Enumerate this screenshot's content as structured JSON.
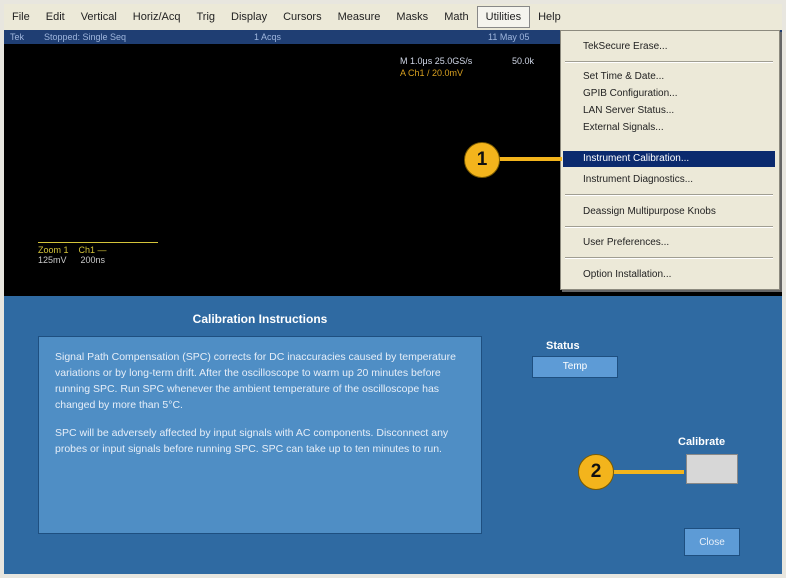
{
  "menubar": {
    "items": [
      "File",
      "Edit",
      "Vertical",
      "Horiz/Acq",
      "Trig",
      "Display",
      "Cursors",
      "Measure",
      "Masks",
      "Math",
      "Utilities",
      "Help"
    ],
    "active": "Utilities"
  },
  "scope": {
    "status": {
      "channel": "Tek",
      "state": "Stopped: Single Seq",
      "acqs": "1 Acqs",
      "date": "11 May 05"
    },
    "timebase": "M 1.0μs 25.0GS/s",
    "timebase_extra": "50.0k",
    "trigger": "A  Ch1  /  20.0mV",
    "ch_readout": {
      "row1_a": "Zoom 1",
      "row1_b": "Ch1 —",
      "row2_a": "125mV",
      "row2_b": "200ns"
    }
  },
  "utilities_menu": {
    "items": [
      {
        "label": "TekSecure Erase...",
        "group": 1
      },
      {
        "label": "Set Time & Date...",
        "group": 2
      },
      {
        "label": "GPIB Configuration...",
        "group": 2
      },
      {
        "label": "LAN Server Status...",
        "group": 2
      },
      {
        "label": "External Signals...",
        "group": 2
      },
      {
        "label": "Instrument Calibration...",
        "group": 2,
        "selected": true
      },
      {
        "label": "Instrument Diagnostics...",
        "group": 2
      },
      {
        "label": "Deassign Multipurpose Knobs",
        "group": 3
      },
      {
        "label": "User Preferences...",
        "group": 4
      },
      {
        "label": "Option Installation...",
        "group": 5
      }
    ]
  },
  "callouts": {
    "one": "1",
    "two": "2"
  },
  "calibration": {
    "title": "Calibration Instructions",
    "paragraph1": "Signal Path Compensation (SPC) corrects for DC inaccuracies caused by temperature variations or by long-term drift. After the oscilloscope to warm up 20 minutes before running SPC. Run SPC whenever the ambient temperature of the oscilloscope has changed by more than 5°C.",
    "paragraph2": "SPC will be adversely affected by input signals with AC components. Disconnect any probes or input signals before running SPC. SPC can take up to ten minutes to run.",
    "status_label": "Status",
    "status_value": "Temp",
    "calibrate_label": "Calibrate",
    "close_label": "Close"
  },
  "colors": {
    "callout": "#f3b41c",
    "panel": "#2f6aa2",
    "selection": "#0b2a6e"
  }
}
